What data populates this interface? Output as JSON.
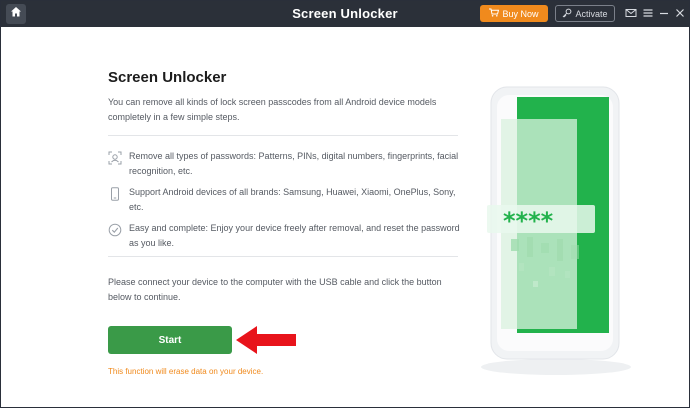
{
  "window": {
    "title": "Screen Unlocker",
    "buy_label": "Buy Now",
    "activate_label": "Activate"
  },
  "icons": {
    "home": "home-icon",
    "cart": "cart-icon",
    "key": "key-icon",
    "mail": "mail-icon",
    "menu": "menu-icon",
    "minimize": "minimize-icon",
    "close": "close-icon"
  },
  "main": {
    "title": "Screen Unlocker",
    "description": "You can remove all kinds of lock screen passcodes from all Android device models completely in a few simple steps.",
    "features": [
      {
        "icon": "face-scan-icon",
        "text": "Remove all types of passwords: Patterns, PINs, digital numbers, fingerprints, facial recognition, etc."
      },
      {
        "icon": "phone-icon",
        "text": "Support Android devices of all brands: Samsung, Huawei, Xiaomi, OnePlus, Sony, etc."
      },
      {
        "icon": "check-circle-icon",
        "text": "Easy and complete: Enjoy your device freely after removal, and reset the password as you like."
      }
    ],
    "connect_text": "Please connect your device to the computer with the USB cable and click the button below to continue.",
    "start_label": "Start",
    "warning": "This function will erase data on your device.",
    "password_mask": "****"
  },
  "colors": {
    "titlebar": "#2b3039",
    "buy_button": "#f08a1d",
    "start_button": "#3a9a48",
    "warning_text": "#f08a1d",
    "arrow": "#e8141b",
    "illustration_green": "#22b24c"
  }
}
